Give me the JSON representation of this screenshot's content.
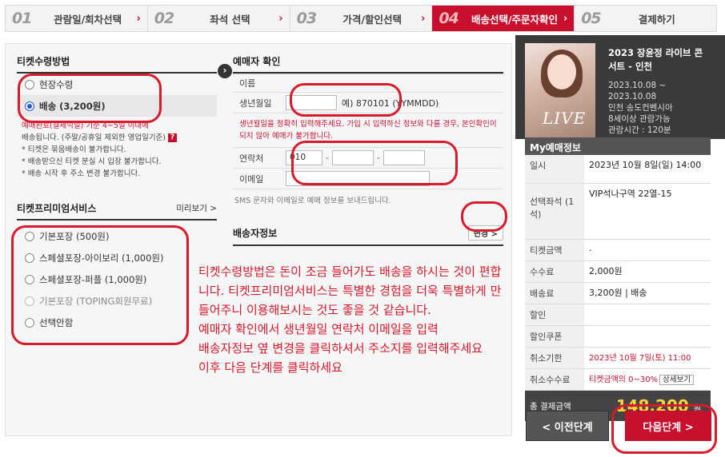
{
  "steps": [
    {
      "num": "01",
      "label": "관람일/회차선택"
    },
    {
      "num": "02",
      "label": "좌석 선택"
    },
    {
      "num": "03",
      "label": "가격/할인선택"
    },
    {
      "num": "04",
      "label": "배송선택/주문자확인"
    },
    {
      "num": "05",
      "label": "결제하기"
    }
  ],
  "ticket_receive": {
    "title": "티켓수령방법",
    "options": [
      "현장수령",
      "배송 (3,200원)"
    ],
    "notes": [
      "예매완료(결제익일) 기준 4~5일 이내에",
      "배송됩니다. (주말/공휴일 제외한 영업일기준)",
      "* 티켓은 묶음배송이 불가합니다.",
      "* 배송받으신 티켓 분실 시 입장 불가합니다.",
      "* 배송 시작 후 주소 변경 불가합니다."
    ]
  },
  "premium": {
    "title": "티켓프리미엄서비스",
    "more": "미리보기 >",
    "options": [
      "기본포장 (500원)",
      "스페셜포장-아이보리 (1,000원)",
      "스페셜포장-퍼플 (1,000원)",
      "기본포장 (TOPING회원무료)",
      "선택안함"
    ]
  },
  "buyer": {
    "title": "예매자 확인",
    "name_label": "이름",
    "birth_label": "생년월일",
    "birth_hint": "예) 870101 (YYMMDD)",
    "warning": "생년월일을 정확히 입력해주세요. 가입 시 입력하신 정보와 다를 경우, 본인확인이 되지 않아 예매가 불가합니다.",
    "phone_label": "연락처",
    "phone_prefix": "010",
    "email_label": "이메일",
    "sms_note": "SMS 문자와 이메일로 예매 정보를 보내드립니다."
  },
  "delivery": {
    "title": "배송자정보",
    "change": "변경 >"
  },
  "annotation": [
    "티켓수령방법은 돈이 조금 들어가도 배송을 하시는 것이 편합니다. 티켓프리미엄서비스는 특별한 경험을 더욱 특별하게 만들어주니 이용해보시는 것도 좋을 것 같습니다.",
    "예매자 확인에서 생년월일 연락처 이메일을 입력",
    "배송자정보 옆 변경을 클릭하셔서 주소지를 입력해주세요",
    "이후 다음 단계를 클릭하세요"
  ],
  "performance": {
    "poster_text": "LIVE",
    "title": "2023 장윤정 라이브 콘서트 - 인천",
    "date": "2023.10.08 ~ 2023.10.08",
    "venue": "인천 송도컨벤시아",
    "age": "8세이상 관람가능",
    "runtime": "관람시간 : 120분"
  },
  "my_booking": {
    "title": "My예매정보",
    "rows": [
      {
        "label": "일시",
        "value": "2023년 10월 8일(일) 14:00"
      },
      {
        "label": "선택좌석 (1석)",
        "value": "VIP석나구역 22열-15"
      },
      {
        "label": "티켓금액",
        "value": "."
      },
      {
        "label": "수수료",
        "value": "2,000원"
      },
      {
        "label": "배송료",
        "value": "3,200원 | 배송"
      },
      {
        "label": "할인",
        "value": ""
      },
      {
        "label": "할인쿠폰",
        "value": ""
      },
      {
        "label": "취소기한",
        "value": "2023년 10월 7일(토) 11:00"
      },
      {
        "label": "취소수수료",
        "value": "티켓금액의 0~30%"
      }
    ],
    "detail_btn": "상세보기",
    "total_label": "총 결제금액",
    "total_value": "148,200",
    "total_unit": "원"
  },
  "buttons": {
    "prev": "<  이전단계",
    "next": "다음단계  >"
  }
}
